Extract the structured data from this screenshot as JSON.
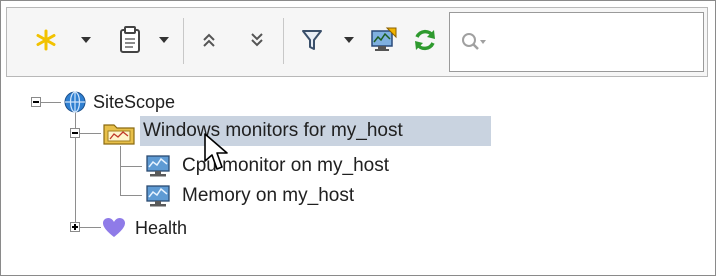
{
  "toolbar": {
    "buttons": [
      {
        "name": "new-icon",
        "color": "#f2c200"
      },
      {
        "name": "clipboard-icon"
      },
      {
        "name": "expand-all-icon"
      },
      {
        "name": "collapse-all-icon"
      },
      {
        "name": "filter-icon"
      },
      {
        "name": "monitor-deploy-icon"
      },
      {
        "name": "refresh-icon",
        "color": "#2e9a2e"
      }
    ],
    "search": {
      "placeholder": "",
      "value": "",
      "icon": "search-icon"
    }
  },
  "tree": {
    "root": {
      "label": "SiteScope",
      "icon": "globe-icon",
      "expanded": true
    },
    "group": {
      "label": "Windows monitors for my_host",
      "icon": "folder-icon",
      "selected": true,
      "expanded": true
    },
    "monitors": [
      {
        "label": "Cpu monitor on my_host",
        "icon": "monitor-icon"
      },
      {
        "label": "Memory on my_host",
        "icon": "monitor-icon"
      }
    ],
    "health": {
      "label": "Health",
      "icon": "heart-icon",
      "expanded": false
    }
  },
  "colors": {
    "selection": "#c9d3e0",
    "heart": "#8f7be8",
    "accent_yellow": "#f2c200",
    "refresh_green": "#2e9a2e"
  }
}
